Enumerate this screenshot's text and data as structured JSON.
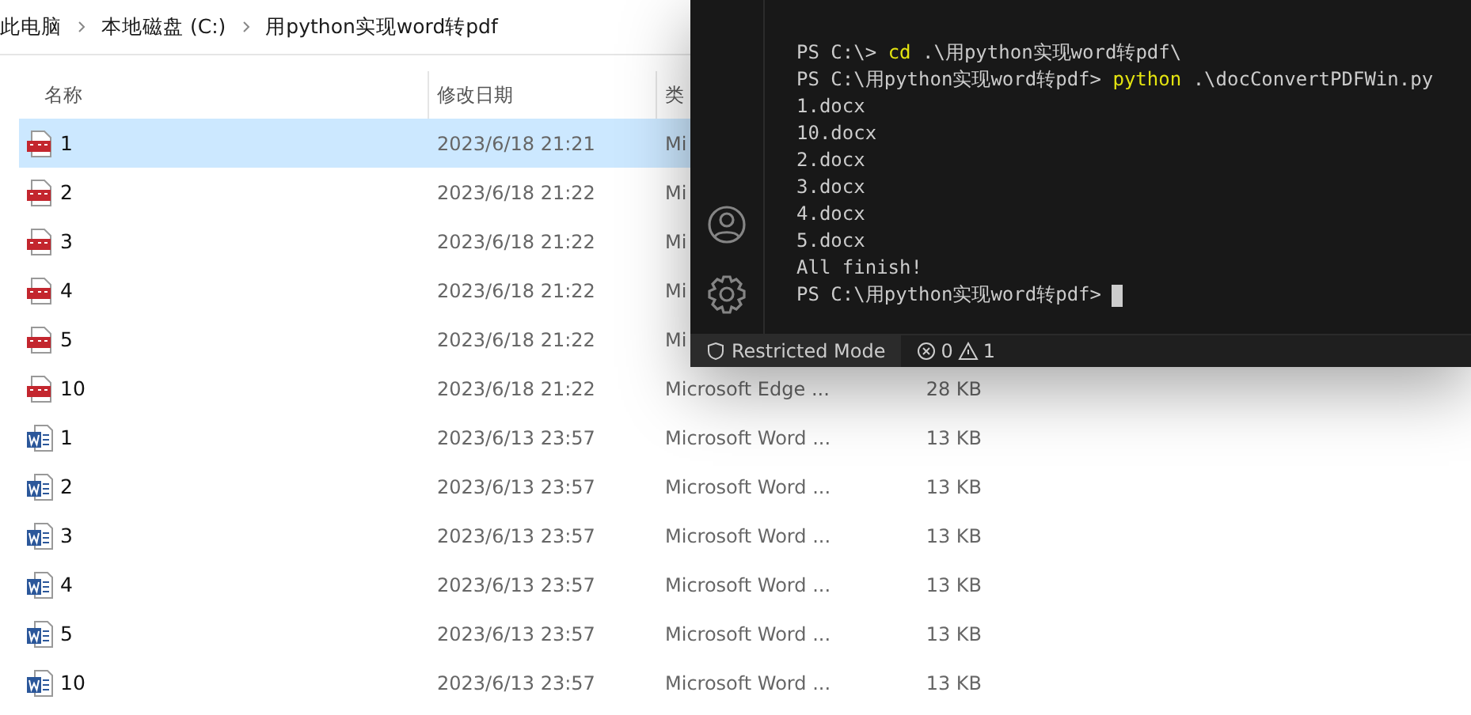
{
  "breadcrumb": [
    "此电脑",
    "本地磁盘 (C:)",
    "用python实现word转pdf"
  ],
  "columns": [
    "名称",
    "修改日期",
    "类"
  ],
  "files": [
    {
      "kind": "pdf",
      "name": "1",
      "modified": "2023/6/18 21:21",
      "type": "Mi",
      "selected": true
    },
    {
      "kind": "pdf",
      "name": "2",
      "modified": "2023/6/18 21:22",
      "type": "Mi",
      "selected": false
    },
    {
      "kind": "pdf",
      "name": "3",
      "modified": "2023/6/18 21:22",
      "type": "Mi",
      "selected": false
    },
    {
      "kind": "pdf",
      "name": "4",
      "modified": "2023/6/18 21:22",
      "type": "Mi",
      "selected": false
    },
    {
      "kind": "pdf",
      "name": "5",
      "modified": "2023/6/18 21:22",
      "type": "Mi",
      "selected": false
    },
    {
      "kind": "pdf",
      "name": "10",
      "modified": "2023/6/18 21:22",
      "type": "Microsoft Edge ...",
      "size": "28 KB",
      "selected": false
    },
    {
      "kind": "word",
      "name": "1",
      "modified": "2023/6/13 23:57",
      "type": "Microsoft Word ...",
      "size": "13 KB",
      "selected": false
    },
    {
      "kind": "word",
      "name": "2",
      "modified": "2023/6/13 23:57",
      "type": "Microsoft Word ...",
      "size": "13 KB",
      "selected": false
    },
    {
      "kind": "word",
      "name": "3",
      "modified": "2023/6/13 23:57",
      "type": "Microsoft Word ...",
      "size": "13 KB",
      "selected": false
    },
    {
      "kind": "word",
      "name": "4",
      "modified": "2023/6/13 23:57",
      "type": "Microsoft Word ...",
      "size": "13 KB",
      "selected": false
    },
    {
      "kind": "word",
      "name": "5",
      "modified": "2023/6/13 23:57",
      "type": "Microsoft Word ...",
      "size": "13 KB",
      "selected": false
    },
    {
      "kind": "word",
      "name": "10",
      "modified": "2023/6/13 23:57",
      "type": "Microsoft Word ...",
      "size": "13 KB",
      "selected": false
    }
  ],
  "terminal": {
    "lines": [
      {
        "kind": "command",
        "prompt": "PS C:\\>",
        "command": "cd",
        "args": ".\\用python实现word转pdf\\"
      },
      {
        "kind": "command",
        "prompt": "PS C:\\用python实现word转pdf>",
        "command": "python",
        "args": ".\\docConvertPDFWin.py"
      },
      {
        "kind": "output",
        "text": "1.docx"
      },
      {
        "kind": "output",
        "text": "10.docx"
      },
      {
        "kind": "output",
        "text": "2.docx"
      },
      {
        "kind": "output",
        "text": "3.docx"
      },
      {
        "kind": "output",
        "text": "4.docx"
      },
      {
        "kind": "output",
        "text": "5.docx"
      },
      {
        "kind": "output",
        "text": "All finish!"
      },
      {
        "kind": "cursor",
        "prompt": "PS C:\\用python实现word转pdf>"
      }
    ]
  },
  "status_bar": {
    "mode": "Restricted Mode",
    "errors": "0",
    "warnings": "1"
  }
}
